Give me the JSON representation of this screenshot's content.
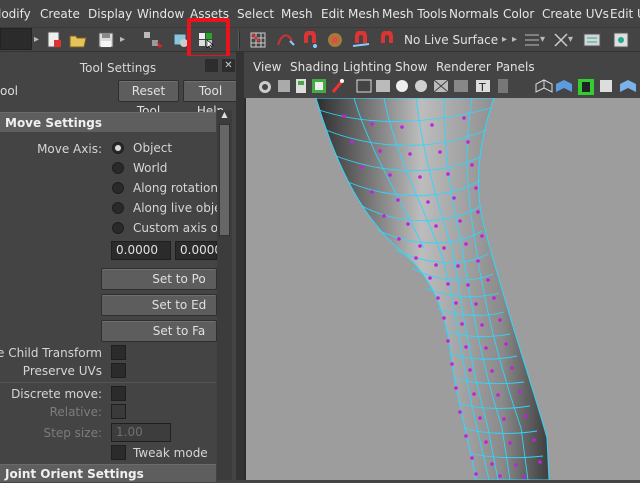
{
  "menubar": {
    "items": [
      "lodify",
      "Create",
      "Display",
      "Window",
      "Assets",
      "Select",
      "Mesh",
      "Edit Mesh",
      "Mesh Tools",
      "Normals",
      "Color",
      "Create UVs",
      "Edit U"
    ]
  },
  "toolbar": {
    "live_surface": "No Live Surface",
    "icons": [
      "new-scene-icon",
      "open-scene-icon",
      "save-scene-icon",
      "select-hierarchy-icon",
      "select-object-icon",
      "select-component-icon",
      "snap-grid-icon",
      "snap-curve-icon",
      "snap-point-icon",
      "snap-view-plane-icon",
      "snap-surface-icon",
      "make-live-icon",
      "input-ops-icon",
      "output-ops-icon",
      "construction-history-icon",
      "render-icon"
    ],
    "highlight_color": "#e8141c"
  },
  "tool_settings": {
    "title": "Tool Settings",
    "tool_name": "ool",
    "reset_button": "Reset Tool",
    "help_button": "Tool Help",
    "move_settings_header": "Move Settings",
    "move_axis_label": "Move Axis:",
    "move_axis_options": [
      "Object",
      "World",
      "Along rotation axi",
      "Along live object a",
      "Custom axis orien"
    ],
    "move_axis_selected": "Object",
    "custom_axis_x": "0.0000",
    "custom_axis_y": "0.0000",
    "set_to_point_button": "Set to Po",
    "set_to_edge_button": "Set to Ed",
    "set_to_face_button": "Set to Fa",
    "preserve_child_label": "serve Child Transform",
    "preserve_uvs_label": "Preserve UVs",
    "discrete_move_label": "Discrete move:",
    "relative_label": "Relative:",
    "step_size_label": "Step size:",
    "step_size_value": "1.00",
    "tweak_mode_label": "Tweak mode",
    "joint_orient_header": "Joint Orient Settings"
  },
  "viewport": {
    "menus": [
      "View",
      "Shading",
      "Lighting",
      "Show",
      "Renderer",
      "Panels"
    ],
    "wire_color": "#2fd6ff",
    "vertex_color": "#c020e0",
    "bg_color": "#9d9d9d"
  }
}
